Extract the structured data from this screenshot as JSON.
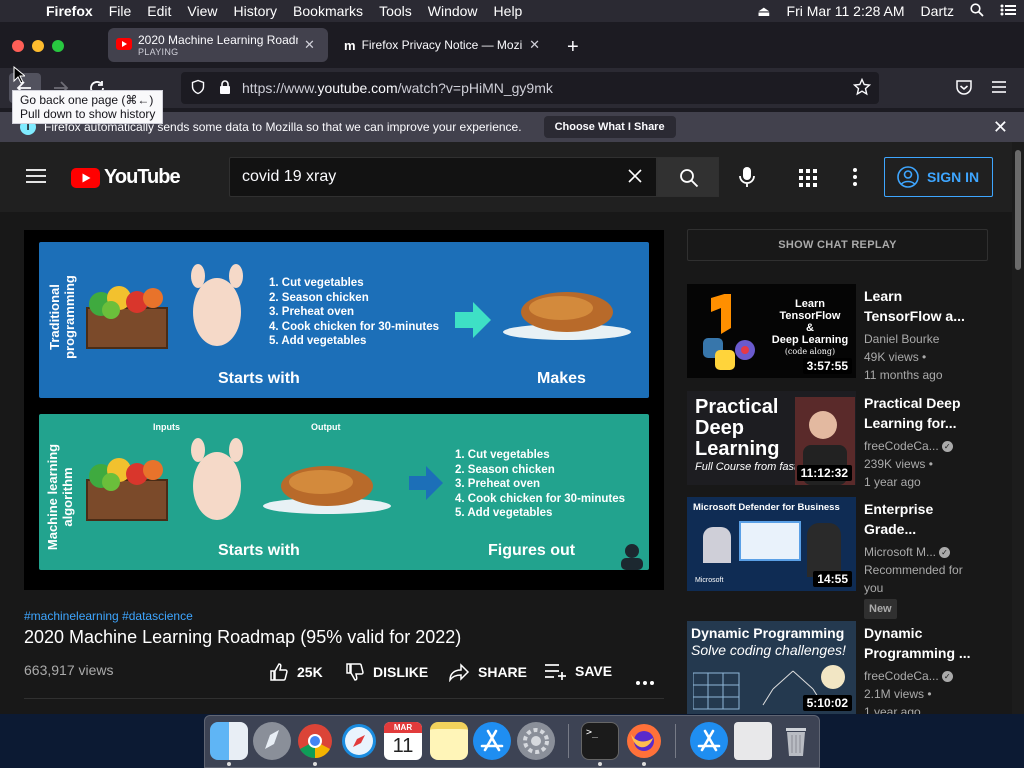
{
  "menubar": {
    "app_name": "Firefox",
    "items": [
      "File",
      "Edit",
      "View",
      "History",
      "Bookmarks",
      "Tools",
      "Window",
      "Help"
    ],
    "datetime": "Fri Mar 11  2:28 AM",
    "user": "Dartz"
  },
  "tabs": [
    {
      "title": "2020 Machine Learning Roadmap",
      "subtitle": "PLAYING",
      "active": true
    },
    {
      "title": "Firefox Privacy Notice — Mozilla",
      "active": false
    }
  ],
  "url": {
    "prefix": "https://www.",
    "domain": "youtube.com",
    "path": "/watch?v=pHiMN_gy9mk"
  },
  "tooltip": {
    "line1": "Go back one page (⌘←)",
    "line2": "Pull down to show history"
  },
  "notification": {
    "message": "Firefox automatically sends some data to Mozilla so that we can improve your experience.",
    "button": "Choose What I Share"
  },
  "youtube": {
    "logo_text": "YouTube",
    "search_value": "covid 19 xray",
    "sign_in": "SIGN IN",
    "video": {
      "hashtags": "#machinelearning #datascience",
      "title": "2020 Machine Learning Roadmap (95% valid for 2022)",
      "views": "663,917 views",
      "likes": "25K",
      "dislike": "DISLIKE",
      "share": "SHARE",
      "save": "SAVE"
    },
    "slide": {
      "top_label": "Traditional programming",
      "bottom_label": "Machine learning algorithm",
      "steps": [
        "1.  Cut vegetables",
        "2.  Season chicken",
        "3.  Preheat oven",
        "4.  Cook chicken for 30-minutes",
        "5.  Add vegetables"
      ],
      "starts_with": "Starts with",
      "makes": "Makes",
      "figures_out": "Figures out",
      "inputs": "Inputs",
      "output": "Output"
    },
    "chat_replay": "SHOW CHAT REPLAY",
    "recommendations": [
      {
        "title": "Learn TensorFlow a...",
        "channel": "Daniel Bourke",
        "views": "49K views •",
        "age": "11 months ago",
        "duration": "3:57:55",
        "thumb_text": [
          "Learn",
          "TensorFlow",
          "&",
          "Deep Learning",
          "(code along)"
        ],
        "verified": false
      },
      {
        "title": "Practical Deep Learning for...",
        "channel": "freeCodeCa...",
        "views": "239K views •",
        "age": "1 year ago",
        "duration": "11:12:32",
        "thumb_text": [
          "Practical",
          "Deep",
          "Learning",
          "Full Course from fast"
        ],
        "verified": true
      },
      {
        "title": "Enterprise Grade...",
        "channel": "Microsoft M...",
        "views": "Recommended for you",
        "age": "",
        "badge": "New",
        "duration": "14:55",
        "thumb_text": [
          "Microsoft Defender for Business",
          "Microsoft"
        ],
        "verified": true
      },
      {
        "title": "Dynamic Programming ...",
        "channel": "freeCodeCa...",
        "views": "2.1M views •",
        "age": "1 year ago",
        "duration": "5:10:02",
        "thumb_text": [
          "Dynamic Programming",
          "Solve coding challenges!"
        ],
        "verified": true
      }
    ]
  },
  "dock": {
    "apps": [
      "Finder",
      "Launchpad",
      "Chrome",
      "Safari",
      "Calendar",
      "Notes",
      "App Store",
      "System Preferences",
      "Terminal",
      "Firefox",
      "App Store Downloads",
      "Preview",
      "Trash"
    ],
    "calendar_month": "MAR",
    "calendar_day": "11"
  },
  "colors": {
    "yt_red": "#ff0000",
    "yt_blue": "#3ea6ff",
    "slide_blue": "#1c6fb8",
    "slide_teal": "#22a38e",
    "ff_toolbar": "#2b2a33"
  }
}
